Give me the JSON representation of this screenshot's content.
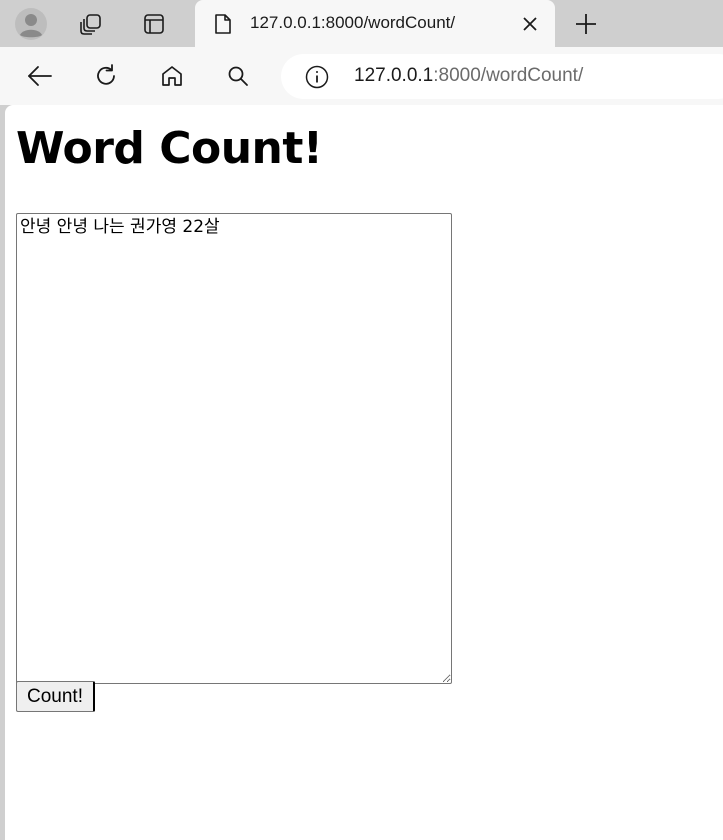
{
  "browser": {
    "tab": {
      "title": "127.0.0.1:8000/wordCount/"
    },
    "address": {
      "host": "127.0.0.1",
      "rest": ":8000/wordCount/"
    },
    "icons": {
      "profile": "profile-icon",
      "workspaces": "workspaces-icon",
      "tab_actions": "tab-actions-icon",
      "favicon": "page-icon",
      "close": "close-icon",
      "new_tab": "plus-icon",
      "back": "back-arrow-icon",
      "refresh": "refresh-icon",
      "home": "home-icon",
      "search": "search-icon",
      "site_info": "info-icon"
    }
  },
  "page": {
    "heading": "Word Count!",
    "textarea": {
      "value": "안녕 안녕 나는 권가영 22살"
    },
    "count_button": "Count!"
  },
  "colors": {
    "tabstrip": "#cfcfcf",
    "toolbar": "#f7f7f7",
    "page": "#ffffff",
    "url_host": "#1b1b1b",
    "url_rest": "#6b6b6b"
  }
}
